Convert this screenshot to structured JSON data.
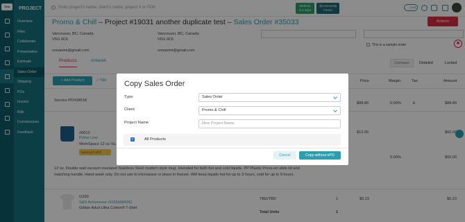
{
  "app": {
    "logo_text": "Tofu"
  },
  "nav": {
    "section": "PROJECT",
    "items": [
      "Overview",
      "Files",
      "Collaborate",
      "Presentation",
      "Estimate",
      "Sales Order",
      "Shipping",
      "POs",
      "Invoice",
      "Bills",
      "Commissions",
      "Feedback"
    ],
    "active_index": 5
  },
  "topbar": {
    "search_placeholder": "Enter project's name, client's name, project # or PO#",
    "webinar_line1": "Webinar",
    "webinar_line2": "in 6 days",
    "community_line1": "@community",
    "community_line2": "Forum",
    "chat_label": "Chat"
  },
  "header": {
    "client": "Promo & Chill",
    "sep1": " – ",
    "project": "Project #19031 another duplicate test",
    "sep2": " – ",
    "sales_order": "Sales Order #35033",
    "actions_label": "Actions"
  },
  "addresses": {
    "left": [
      "Vancouver, BC, Canada",
      "V6G 0C6",
      "",
      "snnaeimi@gmail.com"
    ],
    "right": [
      "Vancouver, BC, Canada",
      "V6G 0C6",
      "",
      "snnaeimi@gmail.com"
    ]
  },
  "sample_label": "This is a sample order",
  "tabs": {
    "products": "Products",
    "artwork": "Artwork"
  },
  "view_toggle": {
    "compact": "Compact",
    "detailed": "Detailed",
    "locked": "Locked"
  },
  "toolbar": {
    "add_product": "+ Add Product",
    "add_title": "+ Title"
  },
  "columns": {
    "price": "Price",
    "margin": "Margin",
    "tax": "Tax",
    "amount": "Amount"
  },
  "rows": {
    "service": {
      "name": "Service PO#38518",
      "price": "$88.89",
      "margin": "0.00%",
      "tax": "E",
      "amount": "$88.89"
    },
    "mug": {
      "sku": "#0012",
      "brand": "Prime Line",
      "name": "WorkSpace 12 oz Va...",
      "price": "$12.00",
      "amount": "$60.00",
      "margin": "0.00%",
      "amount2": "$60.00",
      "warning": "Syncing to ePO",
      "description": "12 oz. Double wall vacuum insulated Stainless Steel modern style mug. Intended for both hot and cold liquids. PP Plastic Press-on slide lid and matching handle. Hand wash only. Do not use in microwave or place in freezer. Will keep liquids hot for up to 3 hours, cold for up to 9 hours."
    },
    "tee": {
      "sku": "G200",
      "brand": "S&S Activewear (4165556666)",
      "name": "Gildan Adult Ultra Cotton® T-Shirt",
      "size": "TBD/TBD",
      "qty": "1",
      "price": "$5.23",
      "amount": "$5.23",
      "total_units_label": "Total Units",
      "total_units": "1"
    }
  },
  "modal": {
    "title": "Copy Sales Order",
    "type_label": "Type",
    "type_value": "Sales Order",
    "client_label": "Client",
    "client_value": "Promo & Chill",
    "project_name_label": "Project Name",
    "project_name_placeholder": "New Project Name",
    "all_products_label": "All Products",
    "all_products_checked": true,
    "cancel_label": "Cancel",
    "copy_label": "Copy without ePO"
  },
  "colors": {
    "teal": "#2a9fb0",
    "sidebar": "#14727f",
    "rail": "#0f5c68",
    "red": "#d6303f"
  }
}
